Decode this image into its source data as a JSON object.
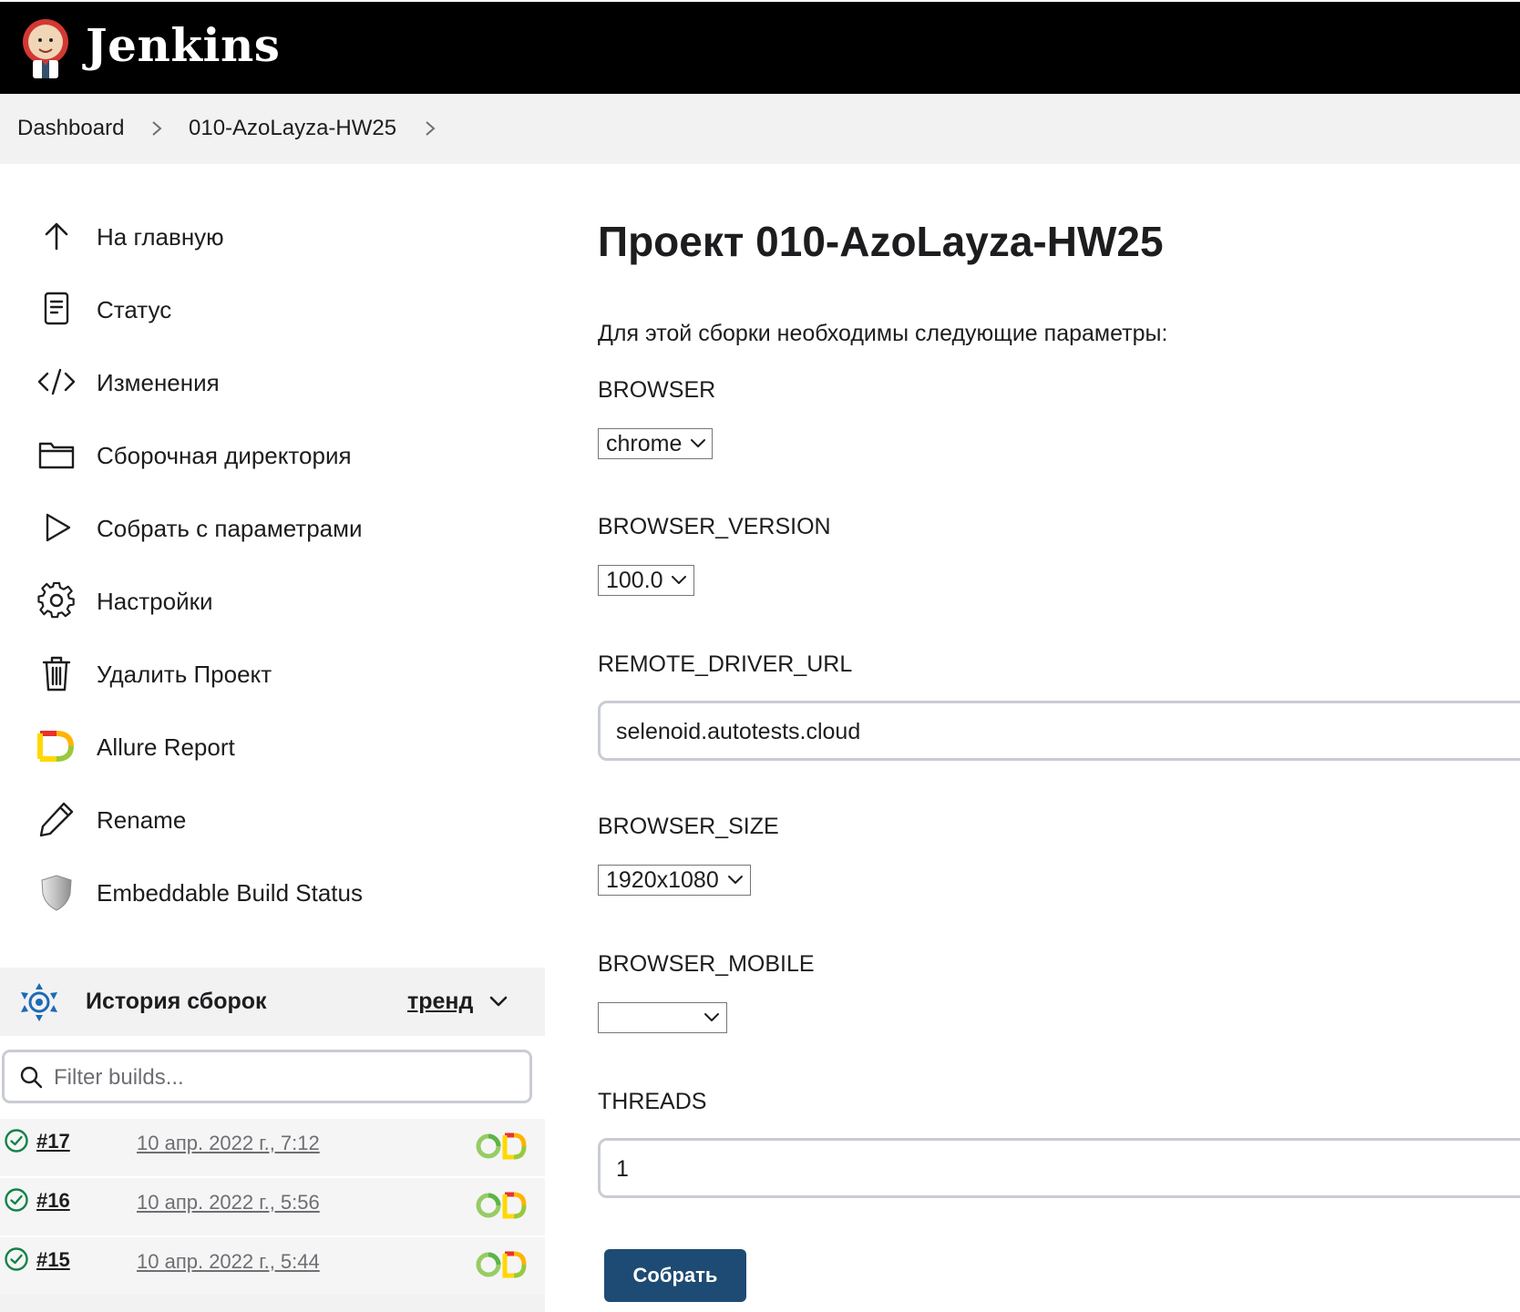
{
  "app": {
    "brand": "Jenkins",
    "logo_icon": "jenkins-butler-logo"
  },
  "breadcrumbs": [
    {
      "label": "Dashboard"
    },
    {
      "label": "010-AzoLayza-HW25"
    }
  ],
  "sidebar": {
    "tasks": [
      {
        "label": "На главную",
        "icon": "arrow-up-icon"
      },
      {
        "label": "Статус",
        "icon": "document-icon"
      },
      {
        "label": "Изменения",
        "icon": "code-icon"
      },
      {
        "label": "Сборочная директория",
        "icon": "folder-icon"
      },
      {
        "label": "Собрать с параметрами",
        "icon": "play-icon"
      },
      {
        "label": "Настройки",
        "icon": "gear-icon"
      },
      {
        "label": "Удалить Проект",
        "icon": "trash-icon"
      },
      {
        "label": "Allure Report",
        "icon": "allure-icon"
      },
      {
        "label": "Rename",
        "icon": "pencil-icon"
      },
      {
        "label": "Embeddable Build Status",
        "icon": "shield-icon"
      }
    ]
  },
  "build_history": {
    "title": "История сборок",
    "trend_label": "тренд",
    "filter_placeholder": "Filter builds...",
    "builds": [
      {
        "number": "#17",
        "date": "10 апр. 2022 г., 7:12",
        "status": "success"
      },
      {
        "number": "#16",
        "date": "10 апр. 2022 г., 5:56",
        "status": "success"
      },
      {
        "number": "#15",
        "date": "10 апр. 2022 г., 5:44",
        "status": "success"
      }
    ]
  },
  "main": {
    "title": "Проект 010-AzoLayza-HW25",
    "intro": "Для этой сборки необходимы следующие параметры:",
    "params": {
      "browser": {
        "name": "BROWSER",
        "value": "chrome"
      },
      "browser_version": {
        "name": "BROWSER_VERSION",
        "value": "100.0"
      },
      "remote_driver_url": {
        "name": "REMOTE_DRIVER_URL",
        "value": "selenoid.autotests.cloud"
      },
      "browser_size": {
        "name": "BROWSER_SIZE",
        "value": "1920x1080"
      },
      "browser_mobile": {
        "name": "BROWSER_MOBILE",
        "value": ""
      },
      "threads": {
        "name": "THREADS",
        "value": "1"
      }
    },
    "submit_label": "Собрать"
  },
  "colors": {
    "header_bg": "#000000",
    "breadcrumb_bg": "#f2f2f3",
    "submit_bg": "#1e4b73",
    "success_green": "#138347",
    "build_history_blue": "#1c6ab5"
  }
}
